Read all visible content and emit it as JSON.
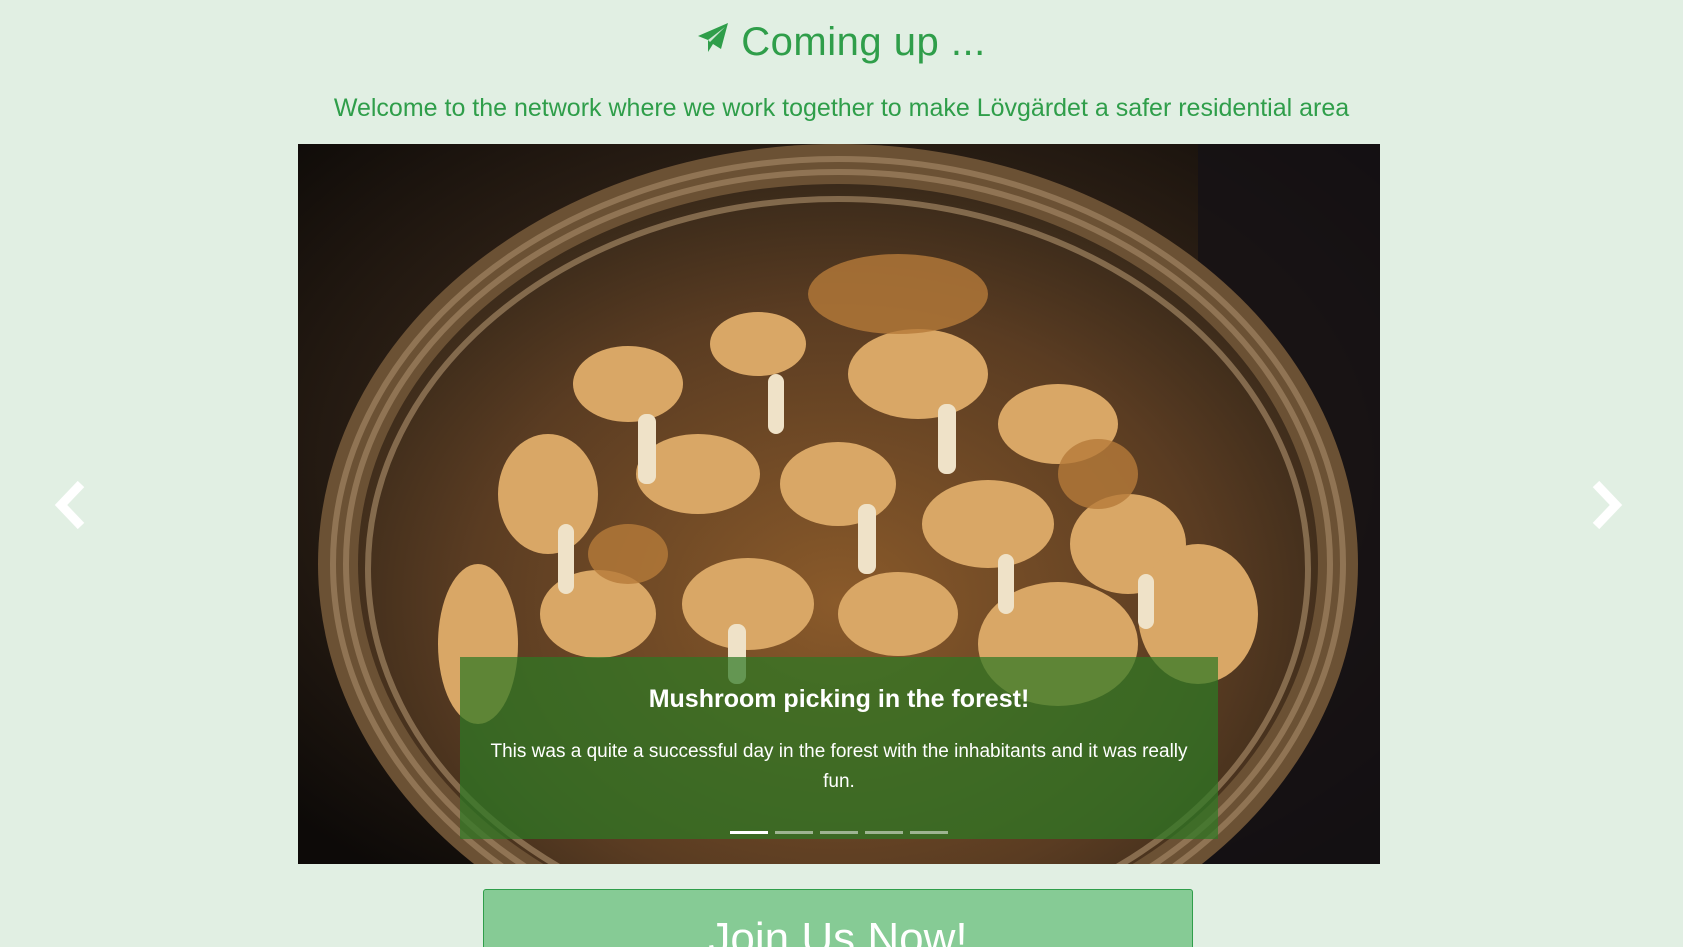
{
  "header": {
    "icon": "paper-plane-icon",
    "title": "Coming up ...",
    "subtitle": "Welcome to the network where we work together to make Lövgärdet a safer residential area"
  },
  "carousel": {
    "active_index": 0,
    "slide_count": 5,
    "image_subject": "mushroom-basket-image",
    "caption_title": "Mushroom picking in the forest!",
    "caption_text": "This was a quite a successful day in the forest with the inhabitants and it was really fun.",
    "prev_icon": "chevron-left-icon",
    "next_icon": "chevron-right-icon"
  },
  "cta": {
    "label": "Join Us Now!"
  },
  "colors": {
    "background": "#e1efe3",
    "accent": "#2f9e4a",
    "caption_bg": "#2e7824",
    "button_bg": "#86cb95"
  }
}
